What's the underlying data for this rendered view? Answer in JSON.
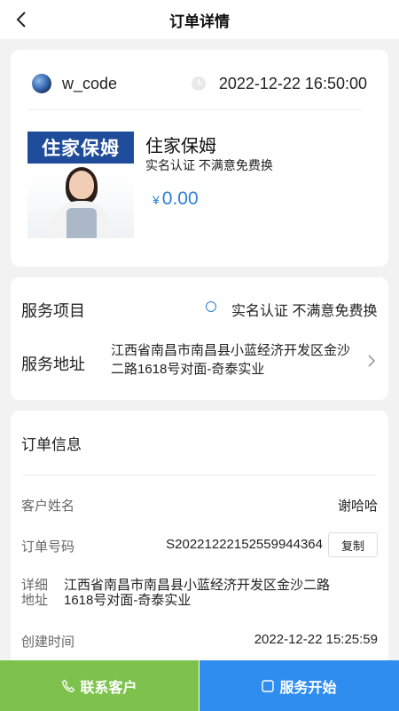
{
  "header": {
    "title": "订单详情"
  },
  "order_card": {
    "username": "w_code",
    "order_time": "2022-12-22 16:50:00",
    "product": {
      "image_banner": "住家保姆",
      "name": "住家保姆",
      "description": "实名认证 不满意免费换",
      "currency": "¥",
      "price": "0.00"
    }
  },
  "service_card": {
    "service_label": "服务项目",
    "service_value": "实名认证 不满意免费换",
    "address_label": "服务地址",
    "address_value": "江西省南昌市南昌县小蓝经济开发区金沙二路1618号对面-奇泰实业"
  },
  "info_card": {
    "title": "订单信息",
    "customer_name_label": "客户姓名",
    "customer_name": "谢哈哈",
    "order_no_label": "订单号码",
    "order_no": "S20221222152559944364",
    "copy_label": "复制",
    "detail_address_label": "详细地址",
    "detail_address": "江西省南昌市南昌县小蓝经济开发区金沙二路1618号对面-奇泰实业",
    "created_label": "创建时间",
    "created_time": "2022-12-22 15:25:59"
  },
  "bottom_bar": {
    "contact_label": "联系客户",
    "start_label": "服务开始"
  },
  "colors": {
    "accent_blue": "#2f7fd6",
    "contact_green": "#7ec24d",
    "start_blue": "#2f8df0"
  },
  "icons": [
    "back-icon",
    "avatar",
    "clock-icon",
    "radio-icon",
    "chevron-right-icon",
    "phone-icon",
    "start-icon"
  ]
}
